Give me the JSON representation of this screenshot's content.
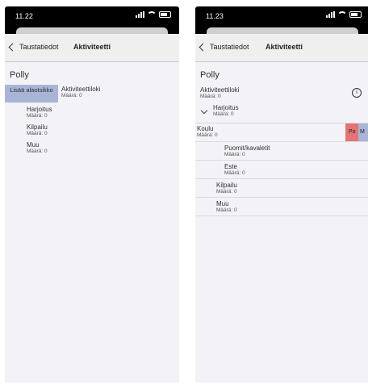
{
  "left": {
    "status": {
      "time": "11.22"
    },
    "nav": {
      "back": "Taustatiedot",
      "title": "Aktiviteetti"
    },
    "page_title": "Polly",
    "add_button": "Lisää alaotsikko",
    "root": {
      "label": "Aktiviteettiloki",
      "count": "Määrä: 0"
    },
    "items": [
      {
        "label": "Harjoitus",
        "count": "Määrä: 0"
      },
      {
        "label": "Kilpailu",
        "count": "Määrä: 0"
      },
      {
        "label": "Muu",
        "count": "Määrä: 0"
      }
    ]
  },
  "right": {
    "status": {
      "time": "11.23"
    },
    "nav": {
      "back": "Taustatiedot",
      "title": "Aktiviteetti"
    },
    "page_title": "Polly",
    "info_icon": "info-icon",
    "root": {
      "label": "Aktiviteettiloki",
      "count": "Määrä: 0"
    },
    "harjoitus": {
      "label": "Harjoitus",
      "count": "Määrä: 0"
    },
    "koulu": {
      "label": "Koulu",
      "count": "Määrä: 0",
      "action_red": "Po",
      "action_blue": "M"
    },
    "sub_items": [
      {
        "label": "Puomit/kavaletit",
        "count": "Määrä: 0"
      },
      {
        "label": "Este",
        "count": "Määrä: 0"
      }
    ],
    "items": [
      {
        "label": "Kilpailu",
        "count": "Määrä: 0"
      },
      {
        "label": "Muu",
        "count": "Määrä: 0"
      }
    ]
  },
  "colors": {
    "swipe_red": "#e37475",
    "swipe_blue": "#aab4d6",
    "add_button": "#aab4d6"
  }
}
